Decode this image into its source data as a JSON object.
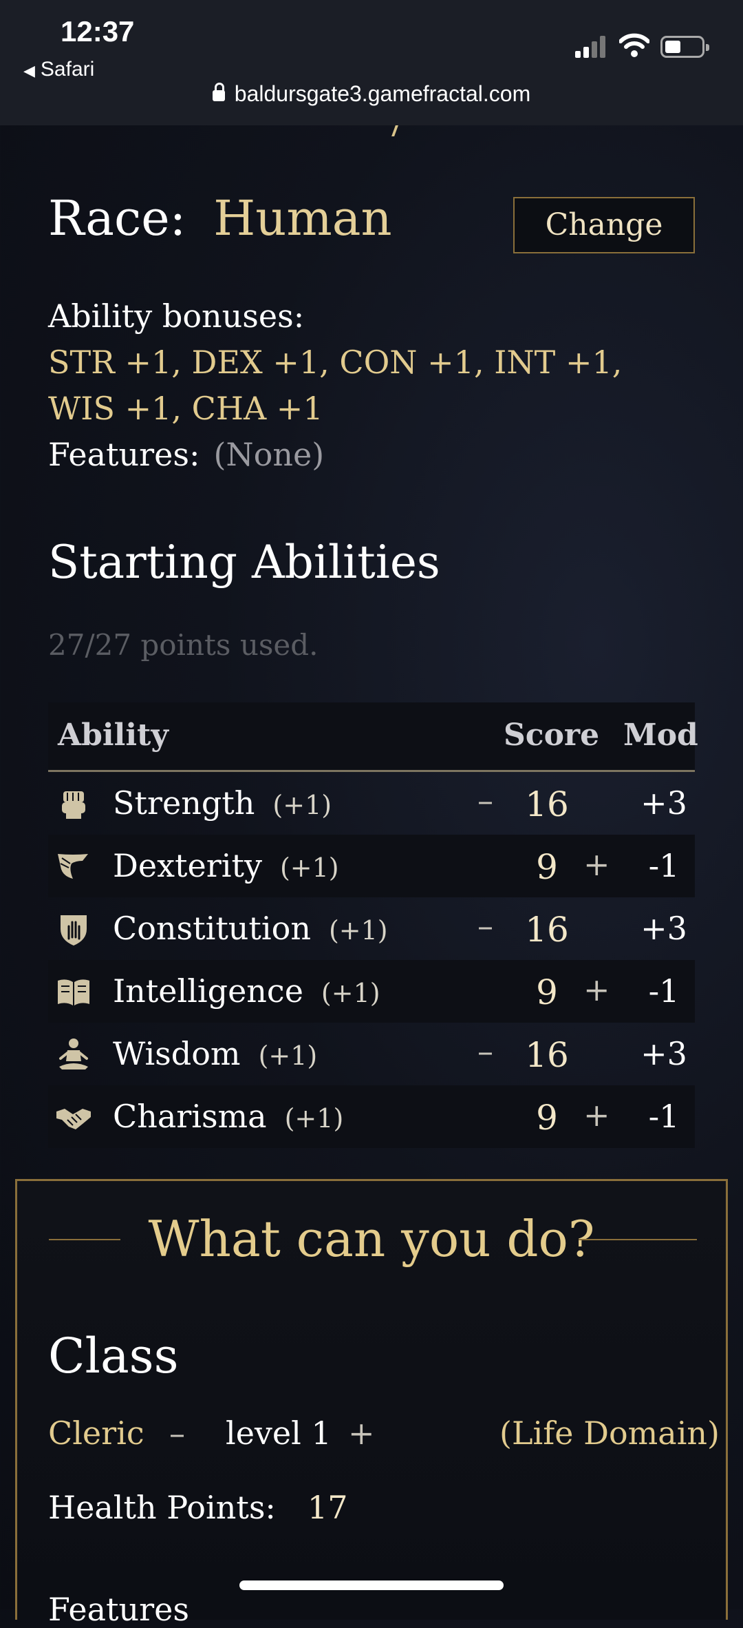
{
  "status_bar": {
    "time": "12:37",
    "back_app": "Safari",
    "url": "baldursgate3.gamefractal.com"
  },
  "race": {
    "label": "Race:",
    "value": "Human",
    "change_button": "Change"
  },
  "bonuses": {
    "label": "Ability bonuses:",
    "line1": "STR +1, DEX +1, CON +1, INT +1,",
    "line2": "WIS +1, CHA +1",
    "features_label": "Features:",
    "features_value": "(None)"
  },
  "abilities_section": {
    "title": "Starting Abilities",
    "points": "27/27 points used.",
    "headers": {
      "ability": "Ability",
      "score": "Score",
      "mod": "Mod"
    },
    "rows": [
      {
        "icon": "fist-icon",
        "name": "Strength",
        "bonus": "(+1)",
        "score": "16",
        "mod": "+3",
        "minus": "–",
        "plus": ""
      },
      {
        "icon": "wing-icon",
        "name": "Dexterity",
        "bonus": "(+1)",
        "score": "9",
        "mod": "-1",
        "minus": "",
        "plus": "+"
      },
      {
        "icon": "shield-hand-icon",
        "name": "Constitution",
        "bonus": "(+1)",
        "score": "16",
        "mod": "+3",
        "minus": "–",
        "plus": ""
      },
      {
        "icon": "book-icon",
        "name": "Intelligence",
        "bonus": "(+1)",
        "score": "9",
        "mod": "-1",
        "minus": "",
        "plus": "+"
      },
      {
        "icon": "meditation-icon",
        "name": "Wisdom",
        "bonus": "(+1)",
        "score": "16",
        "mod": "+3",
        "minus": "–",
        "plus": ""
      },
      {
        "icon": "handshake-icon",
        "name": "Charisma",
        "bonus": "(+1)",
        "score": "9",
        "mod": "-1",
        "minus": "",
        "plus": "+"
      }
    ]
  },
  "what_panel": {
    "heading": "What can you do?",
    "class_title": "Class",
    "class_name": "Cleric",
    "level_minus": "–",
    "level": "level 1",
    "level_plus": "+",
    "subclass": "(Life Domain)",
    "health_label": "Health Points:",
    "health_value": "17",
    "features_label": "Features"
  },
  "colors": {
    "gold": "#e4cf98",
    "border": "#8a6f3a",
    "background": "#0b0d14"
  }
}
